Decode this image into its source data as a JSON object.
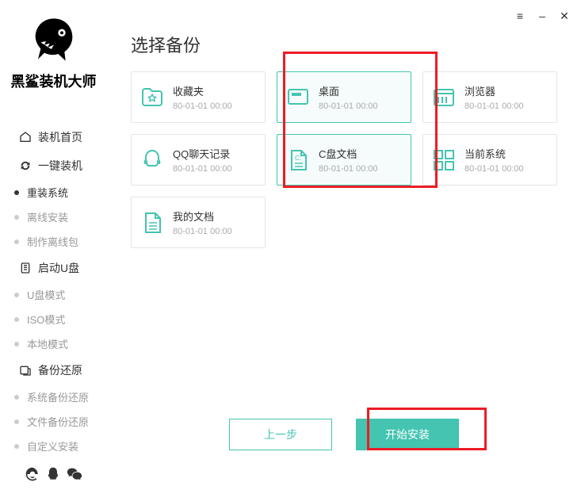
{
  "app": {
    "title": "黑鲨装机大师"
  },
  "nav": {
    "groups": [
      {
        "icon": "home",
        "label": "装机首页",
        "items": []
      },
      {
        "icon": "cycle",
        "label": "一键装机",
        "items": [
          {
            "label": "重装系统",
            "active": true
          },
          {
            "label": "离线安装",
            "active": false
          },
          {
            "label": "制作离线包",
            "active": false
          }
        ]
      },
      {
        "icon": "usb",
        "label": "启动U盘",
        "items": [
          {
            "label": "U盘模式",
            "active": false
          },
          {
            "label": "ISO模式",
            "active": false
          },
          {
            "label": "本地模式",
            "active": false
          }
        ]
      },
      {
        "icon": "restore",
        "label": "备份还原",
        "items": [
          {
            "label": "系统备份还原",
            "active": false
          },
          {
            "label": "文件备份还原",
            "active": false
          },
          {
            "label": "自定义安装",
            "active": false
          }
        ]
      }
    ]
  },
  "page": {
    "title": "选择备份"
  },
  "cards": [
    {
      "icon": "star",
      "title": "收藏夹",
      "sub": "80-01-01 00:00",
      "selected": false
    },
    {
      "icon": "desktop",
      "title": "桌面",
      "sub": "80-01-01 00:00",
      "selected": true
    },
    {
      "icon": "browser",
      "title": "浏览器",
      "sub": "80-01-01 00:00",
      "selected": false
    },
    {
      "icon": "qq",
      "title": "QQ聊天记录",
      "sub": "80-01-01 00:00",
      "selected": false
    },
    {
      "icon": "cdoc",
      "title": "C盘文档",
      "sub": "80-01-01 00:00",
      "selected": true
    },
    {
      "icon": "system",
      "title": "当前系统",
      "sub": "80-01-01 00:00",
      "selected": false
    },
    {
      "icon": "doc",
      "title": "我的文档",
      "sub": "80-01-01 00:00",
      "selected": false
    }
  ],
  "buttons": {
    "prev": "上一步",
    "start": "开始安装"
  },
  "window": {
    "menu": "≡",
    "min": "–",
    "close": "✕"
  }
}
